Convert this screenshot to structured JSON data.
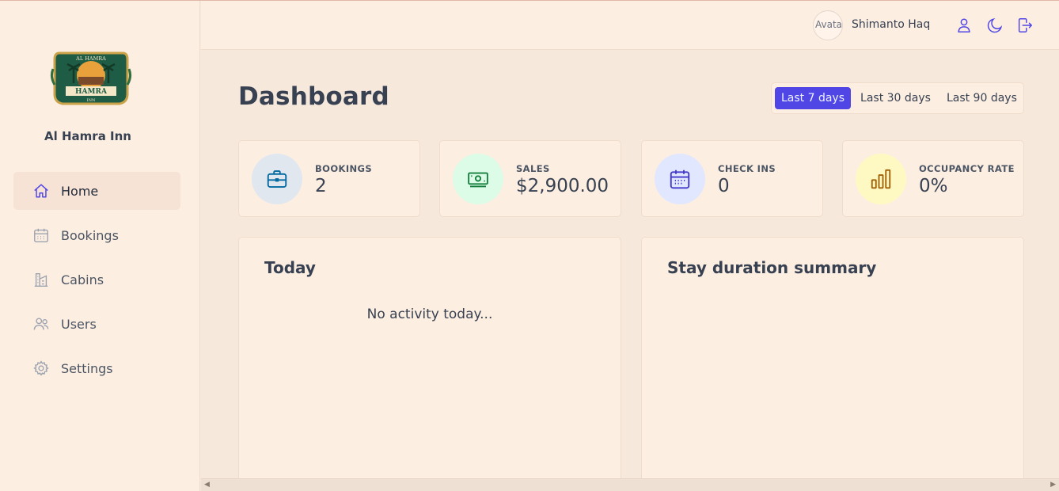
{
  "sidebar": {
    "brand_name": "Al Hamra Inn",
    "logo_text": {
      "top": "AL HAMRA",
      "main": "HAMRA",
      "bottom": "INN"
    },
    "items": [
      {
        "label": "Home",
        "icon": "home-icon",
        "active": true
      },
      {
        "label": "Bookings",
        "icon": "calendar-icon",
        "active": false
      },
      {
        "label": "Cabins",
        "icon": "cabin-icon",
        "active": false
      },
      {
        "label": "Users",
        "icon": "users-icon",
        "active": false
      },
      {
        "label": "Settings",
        "icon": "gear-icon",
        "active": false
      }
    ]
  },
  "header": {
    "avatar_alt": "Avatar",
    "user_name": "Shimanto Haq",
    "buttons": [
      "user-icon",
      "moon-icon",
      "logout-icon"
    ]
  },
  "main": {
    "title": "Dashboard",
    "filter": {
      "options": [
        "Last 7 days",
        "Last 30 days",
        "Last 90 days"
      ],
      "selected": "Last 7 days"
    },
    "stats": [
      {
        "label": "BOOKINGS",
        "value": "2",
        "icon": "briefcase-icon",
        "color": "#0369a1",
        "bg": "#e0e7ef"
      },
      {
        "label": "SALES",
        "value": "$2,900.00",
        "icon": "banknotes-icon",
        "color": "#15803d",
        "bg": "#dcfce7"
      },
      {
        "label": "CHECK INS",
        "value": "0",
        "icon": "calendar-days-icon",
        "color": "#4338ca",
        "bg": "#e0e7ff"
      },
      {
        "label": "OCCUPANCY RATE",
        "value": "0%",
        "icon": "chart-bar-icon",
        "color": "#a16207",
        "bg": "#fef9c3"
      }
    ],
    "today": {
      "title": "Today",
      "empty_message": "No activity today..."
    },
    "duration": {
      "title": "Stay duration summary"
    }
  },
  "colors": {
    "accent": "#4f46e5",
    "sidebar_bg": "#fdeee2",
    "page_bg": "#f7e8dc"
  }
}
